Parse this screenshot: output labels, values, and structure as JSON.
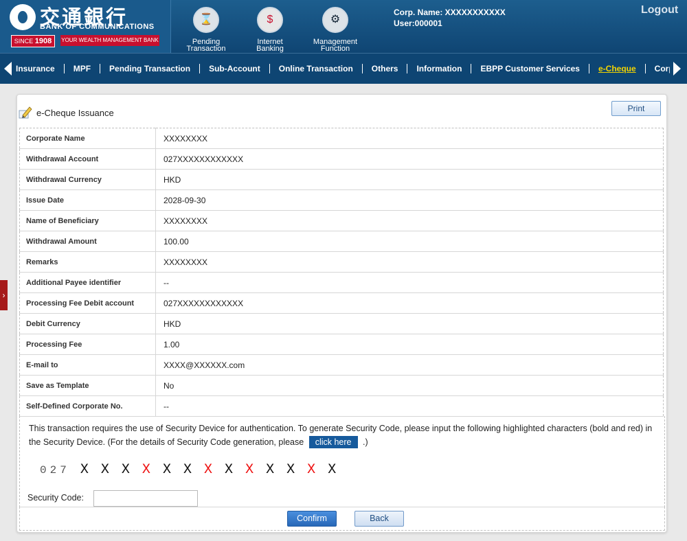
{
  "header": {
    "logo_cn": "交通銀行",
    "logo_en": "BANK OF COMMUNICATIONS",
    "since_prefix": "SINCE",
    "since_year": "1908",
    "slogan": "YOUR WEALTH MANAGEMENT BANK",
    "icons": [
      {
        "label1": "Pending",
        "label2": "Transaction",
        "icon": "hourglass-icon"
      },
      {
        "label1": "Internet",
        "label2": "Banking",
        "icon": "monitor-dollar-icon"
      },
      {
        "label1": "Management",
        "label2": "Function",
        "icon": "gears-icon"
      }
    ],
    "corp_name": "Corp. Name: XXXXXXXXXXX",
    "user": "User:000001",
    "logout": "Logout"
  },
  "nav": {
    "items": [
      "Insurance",
      "MPF",
      "Pending Transaction",
      "Sub-Account",
      "Online Transaction",
      "Others",
      "Information",
      "EBPP Customer Services",
      "e-Cheque",
      "Corpo"
    ],
    "active": "e-Cheque"
  },
  "panel": {
    "title": "e-Cheque Issuance",
    "print_label": "Print"
  },
  "details": [
    {
      "label": "Corporate Name",
      "value": "XXXXXXXX"
    },
    {
      "label": "Withdrawal Account",
      "value": "027XXXXXXXXXXXX"
    },
    {
      "label": "Withdrawal Currency",
      "value": "HKD"
    },
    {
      "label": "Issue Date",
      "value": "2028-09-30"
    },
    {
      "label": "Name of Beneficiary",
      "value": "XXXXXXXX"
    },
    {
      "label": "Withdrawal Amount",
      "value": "100.00"
    },
    {
      "label": "Remarks",
      "value": "XXXXXXXX"
    },
    {
      "label": "Additional Payee identifier",
      "value": "--"
    },
    {
      "label": "Processing Fee Debit account",
      "value": "027XXXXXXXXXXXX"
    },
    {
      "label": "Debit Currency",
      "value": "HKD"
    },
    {
      "label": "Processing Fee",
      "value": "1.00"
    },
    {
      "label": "E-mail to",
      "value": "XXXX@XXXXXX.com"
    },
    {
      "label": "Save as Template",
      "value": "No"
    },
    {
      "label": "Self-Defined Corporate No.",
      "value": "--"
    }
  ],
  "security": {
    "text_before": "This transaction requires the use of Security Device for authentication. To generate Security Code, please input the following highlighted characters (bold and red) in the Security Device. (For the details of Security Code generation, please",
    "click_here": "click here",
    "text_after": ".)",
    "prefix": "027",
    "chars": [
      {
        "ch": "X",
        "red": false
      },
      {
        "ch": "X",
        "red": false
      },
      {
        "ch": "X",
        "red": false
      },
      {
        "ch": "X",
        "red": true
      },
      {
        "ch": "X",
        "red": false
      },
      {
        "ch": "X",
        "red": false
      },
      {
        "ch": "X",
        "red": true
      },
      {
        "ch": "X",
        "red": false
      },
      {
        "ch": "X",
        "red": true
      },
      {
        "ch": "X",
        "red": false
      },
      {
        "ch": "X",
        "red": false
      },
      {
        "ch": "X",
        "red": true
      },
      {
        "ch": "X",
        "red": false
      }
    ],
    "code_label": "Security Code:",
    "code_value": ""
  },
  "buttons": {
    "confirm": "Confirm",
    "back": "Back"
  },
  "colors": {
    "header_bg": "#0f4573",
    "active_nav": "#f4d400",
    "brand_red": "#c8102e",
    "highlight_red": "#ee1111"
  }
}
